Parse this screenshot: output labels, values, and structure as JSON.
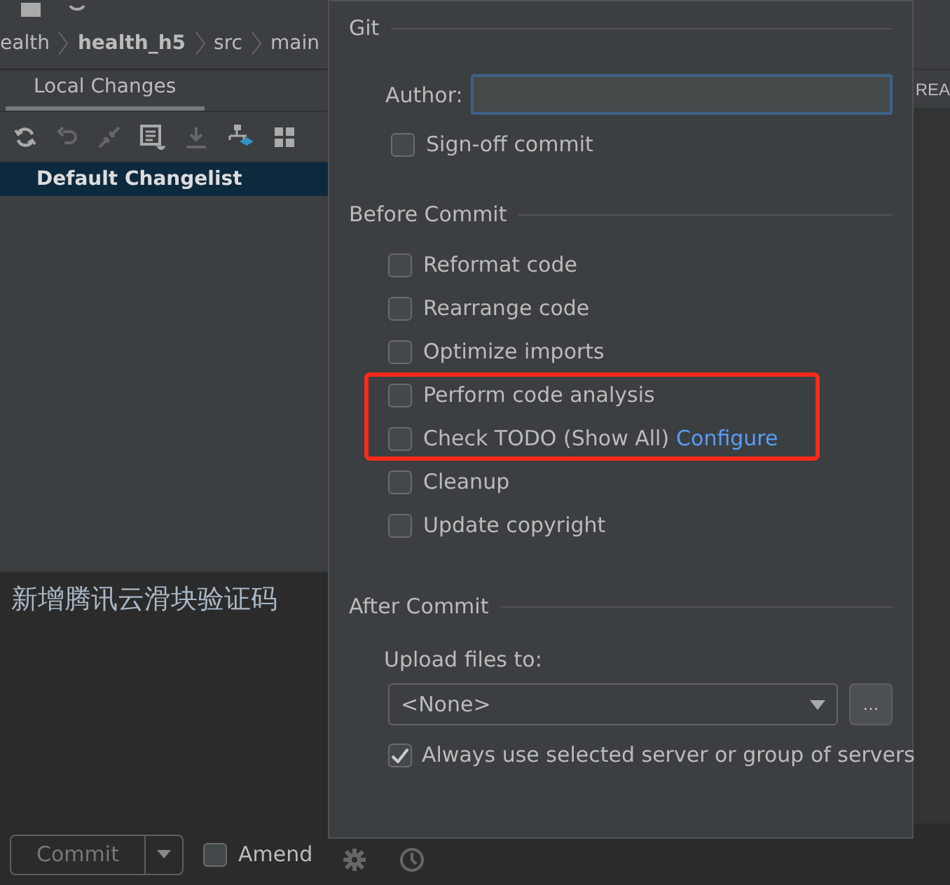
{
  "breadcrumbs": [
    {
      "label": "ealth",
      "bold": false
    },
    {
      "label": "health_h5",
      "bold": true
    },
    {
      "label": "src",
      "bold": false
    },
    {
      "label": "main",
      "bold": false
    }
  ],
  "tabs": [
    {
      "label": "Local Changes",
      "selected": true
    }
  ],
  "changelists": [
    {
      "label": "Default Changelist",
      "selected": true
    }
  ],
  "editor": {
    "tab_label": "REA"
  },
  "commit_message": "新增腾讯云滑块验证码",
  "commit_bar": {
    "commit_button": "Commit",
    "amend": {
      "label": "Amend",
      "checked": false
    }
  },
  "popup": {
    "git": {
      "title": "Git",
      "author": {
        "label": "Author:"
      },
      "sign_off": {
        "label": "Sign-off commit",
        "checked": false
      }
    },
    "before_commit": {
      "title": "Before Commit",
      "groups": [
        {
          "options": [
            {
              "label": "Reformat code",
              "checked": false
            },
            {
              "label": "Rearrange code",
              "checked": false
            },
            {
              "label": "Optimize imports",
              "checked": false
            }
          ]
        },
        {
          "highlighted": true,
          "options": [
            {
              "label": "Perform code analysis",
              "checked": false
            },
            {
              "label": "Check TODO (Show All)",
              "link": "Configure",
              "checked": false
            }
          ]
        },
        {
          "options": [
            {
              "label": "Cleanup",
              "checked": false
            },
            {
              "label": "Update copyright",
              "checked": false
            }
          ]
        }
      ]
    },
    "after_commit": {
      "title": "After Commit",
      "upload_label": "Upload files to:",
      "server": "<None>",
      "browse_button": "...",
      "always_use": {
        "label": "Always use selected server or group of servers",
        "checked": true
      }
    }
  }
}
